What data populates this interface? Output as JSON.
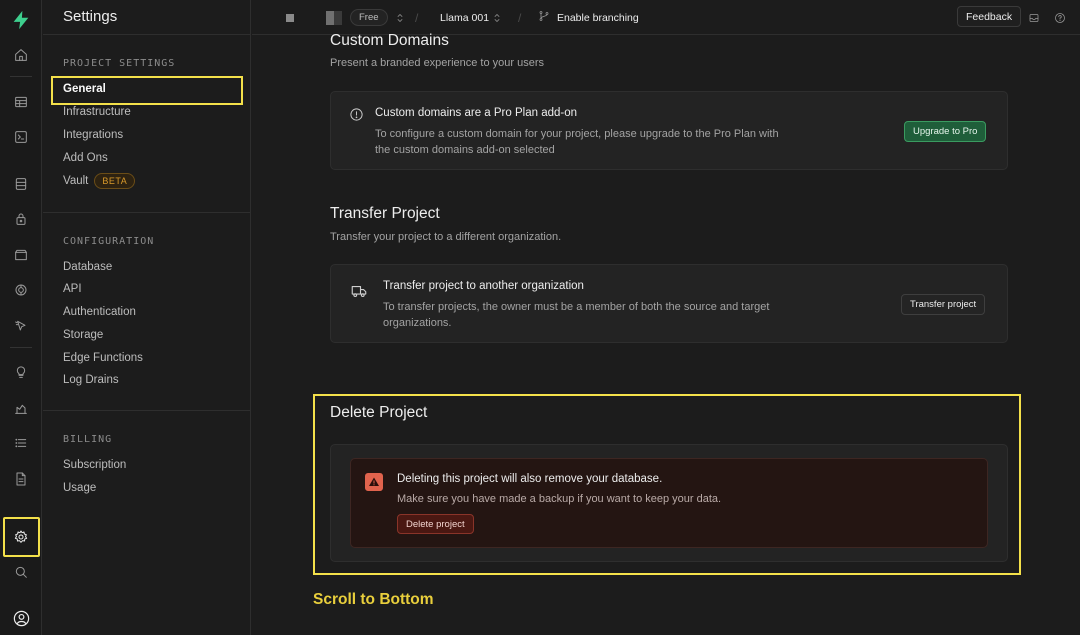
{
  "app": {
    "accent": "#3ecf8e",
    "highlight": "#f3e04a"
  },
  "rail": {
    "icons": [
      "logo-icon",
      "home-icon",
      "table-editor-icon",
      "sql-editor-icon",
      "database-icon",
      "auth-icon",
      "storage-icon",
      "realtime-icon",
      "edge-functions-icon",
      "advisors-icon",
      "reports-icon",
      "logs-icon",
      "api-docs-icon",
      "settings-icon",
      "search-icon",
      "account-icon"
    ]
  },
  "menu": {
    "title": "Settings",
    "project_settings_label": "PROJECT SETTINGS",
    "project_items": [
      {
        "label": "General",
        "active": true
      },
      {
        "label": "Infrastructure"
      },
      {
        "label": "Integrations"
      },
      {
        "label": "Add Ons"
      },
      {
        "label": "Vault",
        "badge": "BETA"
      }
    ],
    "configuration_label": "CONFIGURATION",
    "configuration_items": [
      "Database",
      "API",
      "Authentication",
      "Storage",
      "Edge Functions",
      "Log Drains"
    ],
    "billing_label": "BILLING",
    "billing_items": [
      "Subscription",
      "Usage"
    ]
  },
  "topbar": {
    "plan": "Free",
    "project": "Llama 001",
    "branching": "Enable branching",
    "feedback": "Feedback"
  },
  "custom_domains": {
    "title": "Custom Domains",
    "subtitle": "Present a branded experience to your users",
    "card_title": "Custom domains are a Pro Plan add-on",
    "card_text_1": "To configure a custom domain for your project, please upgrade to the Pro Plan with",
    "card_text_2": "the custom domains add-on selected",
    "button": "Upgrade to Pro"
  },
  "transfer": {
    "title": "Transfer Project",
    "subtitle": "Transfer your project to a different organization.",
    "card_title": "Transfer project to another organization",
    "card_text_1": "To transfer projects, the owner must be a member of both the source and target",
    "card_text_2": "organizations.",
    "button": "Transfer project"
  },
  "delete": {
    "title": "Delete Project",
    "warning_title": "Deleting this project will also remove your database.",
    "warning_text": "Make sure you have made a backup if you want to keep your data.",
    "button": "Delete project"
  },
  "annotation": {
    "scroll_note": "Scroll to Bottom"
  }
}
